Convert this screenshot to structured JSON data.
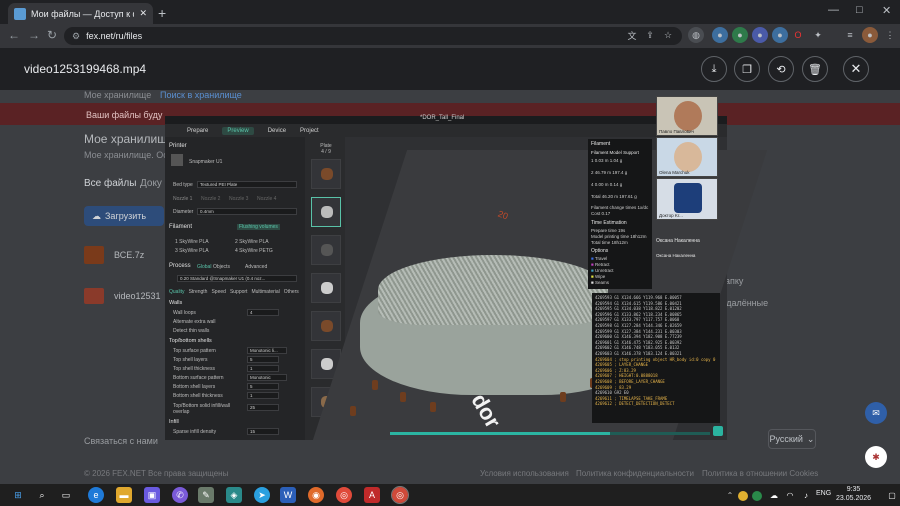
{
  "browser": {
    "tab_title": "Мои файлы — Доступ к ф",
    "new_tab": "+",
    "url": "fex.net/ru/files",
    "window_controls": [
      "—",
      "□",
      "✕"
    ]
  },
  "viewer": {
    "filename": "video1253199468.mp4",
    "actions": [
      "download-icon",
      "copy-icon",
      "link-icon",
      "delete-icon"
    ],
    "close": "✕"
  },
  "site_background": {
    "breadcrumb_1": "Мое хранилище",
    "breadcrumb_2": "Поиск в хранилище",
    "banner_text": "Ваши файлы буду",
    "heading": "Мое хранилище",
    "subheading": "Мое хранилище. Осн",
    "tab_all": "Все файлы",
    "tab_docs": "Доку",
    "upload_button": "Загрузить",
    "file_1": "ВСЕ.7z",
    "file_2": "video12531",
    "side_text_1": "апку",
    "side_text_2": "удалённые",
    "contact": "Связаться с нами",
    "language": "Русский",
    "copyright": "© 2026 FEX.NET Все права защищены",
    "footer_links": [
      "Условия использования",
      "Политика конфиденциальности",
      "Политика в отношении Cookies"
    ]
  },
  "slicer": {
    "title": "*DOR_Tall_Final",
    "menu": [
      "Prepare",
      "Preview",
      "Device",
      "Project"
    ],
    "active_menu": "Preview",
    "printer_label": "Printer",
    "printer_name": "Snapmaker U1",
    "bed_type_label": "Bed type",
    "bed_type_value": "Textured PEI Plate",
    "nozzles": [
      "Nozzle 1",
      "Nozzle 2",
      "Nozzle 3",
      "Nozzle 4"
    ],
    "diameter_label": "Diameter",
    "diameter_value": "0.4mm",
    "filament_label": "Filament",
    "flushing_label": "Flushing volumes",
    "filaments": [
      {
        "num": "1",
        "name": "SkyWire PLA"
      },
      {
        "num": "2",
        "name": "SkyWire PLA"
      },
      {
        "num": "3",
        "name": "SkyWire PLA"
      },
      {
        "num": "4",
        "name": "SkyWire PETG"
      }
    ],
    "process_label": "Process",
    "process_global": "Global",
    "process_objects": "Objects",
    "advanced": "Advanced",
    "profile": "0.20 Standard @Snapmaker U1 (0.4 noz...",
    "setting_tabs": [
      "Quality",
      "Strength",
      "Speed",
      "Support",
      "Multimaterial",
      "Others"
    ],
    "walls_label": "Walls",
    "walls": [
      {
        "name": "Wall loops",
        "value": "4"
      },
      {
        "name": "Alternate extra wall",
        "value": ""
      },
      {
        "name": "Detect thin walls",
        "value": ""
      }
    ],
    "shells_label": "Top/bottom shells",
    "shells": [
      {
        "name": "Top surface pattern",
        "value": "Monotonic li..."
      },
      {
        "name": "Top shell layers",
        "value": "5"
      },
      {
        "name": "Top shell thickness",
        "value": "1"
      },
      {
        "name": "Bottom surface pattern",
        "value": "Monotonic"
      },
      {
        "name": "Bottom shell layers",
        "value": "5"
      },
      {
        "name": "Bottom shell thickness",
        "value": "1"
      },
      {
        "name": "Top/Bottom solid infill/wall overlap",
        "value": "25"
      }
    ],
    "infill_label": "Infill",
    "infill_density_label": "Sparse infill density",
    "infill_density_value": "15",
    "plates_label": "Plate",
    "plates_count": "4 / 9",
    "plate_number_label": "20",
    "stats": {
      "header": "Filament",
      "columns": [
        "Filament",
        "Model",
        "Support"
      ],
      "rows": [
        "1  0.03 m  1.04 g",
        "2  46.79 m  197.4 g",
        "4  0.00 m  0.14 g"
      ],
      "total": "Total  46.20 m  197.61 g",
      "filament_changes": "Filament change times  1x/dc",
      "cost": "Cost  0.17",
      "time_label": "Time Estimation",
      "prepare_time": "Prepare time  19s",
      "printing_time": "Model printing time  18h12m",
      "total_time": "Total time  18h12m",
      "options_label": "Options",
      "options": [
        "Travel",
        "Retract",
        "Unretract",
        "Wipe",
        "Seams"
      ]
    },
    "gcode": [
      "4269593  G1 X134.666 Y119.968 E.00057",
      "4269594  G1 X134.615 Y119.586 E.00421",
      "4269595  G1 X134.038 Y118.822 E.01202",
      "4269596  G1 X133.862 Y118.234 E.00865",
      "4269597  G1 X133.797 Y117.757 E.0068",
      "4269598  G1 X127.284 Y144.346 E.02659",
      "4269599  G1 X127.384 Y144.231 E.00303",
      "4269600  G1 X146.394 Y182.908 E.77239",
      "4269601  G1 X146.475 Y182.925 E.00392",
      "4269602  G1 X146.748 Y183.055 E.0132",
      "4269603  G1 X146.378 Y183.124 E.00321",
      "4269604  ; stop printing object HR_body id:0 copy 0",
      "4269605  ; LAYER_CHANGE",
      "4269606  ; Z:83.29",
      "4269607  ; HEIGHT:0.0888018",
      "4269608  ; BEFORE_LAYER_CHANGE",
      "4269609  ; 83.29",
      "4269610  G92 E0",
      "4269611  ; TIMELAPSE_TAKE_FRAME",
      "4269612  ; DETECT_DETECTION_DETECT"
    ],
    "big_label": "dor"
  },
  "participants": [
    {
      "name": "Павло Павлович"
    },
    {
      "name": "Olena Marchuk"
    },
    {
      "name": "Доктор Kr..."
    },
    {
      "name": "Оксана Накаленна"
    }
  ],
  "participant_4_sub": "Оксана Накаленна",
  "taskbar": {
    "language": "ENG",
    "time": "9:35",
    "date": "23.05.2026"
  }
}
